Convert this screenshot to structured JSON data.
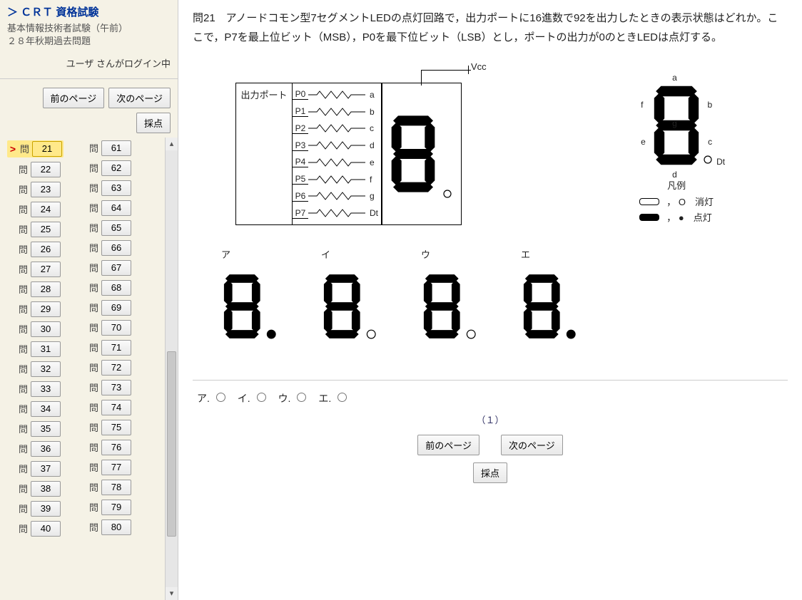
{
  "sidebar": {
    "title": "＞ ＣＲＴ 資格試験",
    "sub1": "基本情報技術者試験（午前）",
    "sub2": "２８年秋期過去問題",
    "login": "ユーザ さんがログイン中",
    "prev": "前のページ",
    "next": "次のページ",
    "score": "採点",
    "col1": [
      21,
      22,
      23,
      24,
      25,
      26,
      27,
      28,
      29,
      30,
      31,
      32,
      33,
      34,
      35,
      36,
      37,
      38,
      39,
      40
    ],
    "col2": [
      61,
      62,
      63,
      64,
      65,
      66,
      67,
      68,
      69,
      70,
      71,
      72,
      73,
      74,
      75,
      76,
      77,
      78,
      79,
      80
    ],
    "question_label": "問",
    "active": 21
  },
  "main": {
    "question": "問21　アノードコモン型7セグメントLEDの点灯回路で，出力ポートに16進数で92を出力したときの表示状態はどれか。ここで，P7を最上位ビット（MSB），P0を最下位ビット（LSB）とし，ポートの出力が0のときLEDは点灯する。",
    "port_box": "出力ポート",
    "vcc": "Vcc",
    "ports": [
      "P0",
      "P1",
      "P2",
      "P3",
      "P4",
      "P5",
      "P6",
      "P7"
    ],
    "segnames": [
      "a",
      "b",
      "c",
      "d",
      "e",
      "f",
      "g",
      "Dt"
    ],
    "legend_title": "凡例",
    "legend_off": "， O　消灯",
    "legend_on": "， ●　点灯",
    "choice_labels": [
      "ア",
      "イ",
      "ウ",
      "エ"
    ],
    "answer_labels": [
      "ア.",
      "イ.",
      "ウ.",
      "エ."
    ],
    "page_indicator": "（１）",
    "prev": "前のページ",
    "next": "次のページ",
    "score": "採点"
  },
  "choices_segments": {
    "main_display": {
      "a": 0,
      "b": 0,
      "c": 0,
      "d": 0,
      "e": 0,
      "f": 0,
      "g": 0,
      "dt": 0
    },
    "map": {
      "a": 0,
      "b": 0,
      "c": 0,
      "d": 0,
      "e": 0,
      "f": 0,
      "g": 0,
      "dt": 0
    },
    "a": {
      "a": 0,
      "b": 0,
      "c": 1,
      "d": 1,
      "e": 1,
      "f": 1,
      "g": 1,
      "dt": 1
    },
    "i": {
      "a": 0,
      "b": 0,
      "c": 1,
      "d": 1,
      "e": 1,
      "f": 1,
      "g": 1,
      "dt": 0
    },
    "u": {
      "a": 1,
      "b": 0,
      "c": 1,
      "d": 1,
      "e": 0,
      "f": 1,
      "g": 1,
      "dt": 0
    },
    "e": {
      "a": 1,
      "b": 0,
      "c": 1,
      "d": 1,
      "e": 0,
      "f": 1,
      "g": 1,
      "dt": 1
    }
  }
}
